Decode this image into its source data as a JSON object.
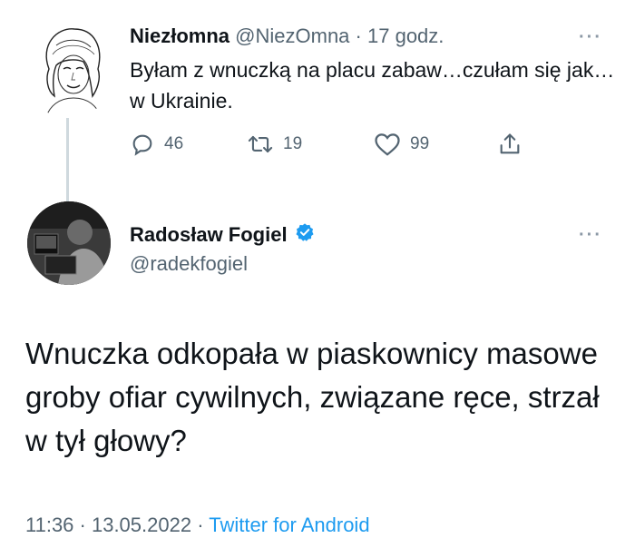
{
  "reply_context": {
    "author_name": "Niezłomna",
    "handle": "@NiezOmna",
    "time": "17 godz.",
    "text": "Byłam z wnuczką na placu zabaw…czułam się jak…w Ukrainie.",
    "more_icon": "more-horizontal-icon",
    "actions": {
      "replies": "46",
      "retweets": "19",
      "likes": "99"
    }
  },
  "main_tweet": {
    "author_name": "Radosław Fogiel",
    "handle": "@radekfogiel",
    "verified_icon": "verified-badge-icon",
    "text": "Wnuczka odkopała w piaskownicy masowe groby ofiar cywilnych, związane ręce, strzał w tył głowy?",
    "timestamp": "11:36 · 13.05.2022 ·",
    "source": "Twitter for Android",
    "more_icon": "more-horizontal-icon"
  },
  "colors": {
    "text": "#0f1419",
    "muted": "#536471",
    "accent": "#1d9bf0",
    "thread_line": "#cfd9de"
  }
}
